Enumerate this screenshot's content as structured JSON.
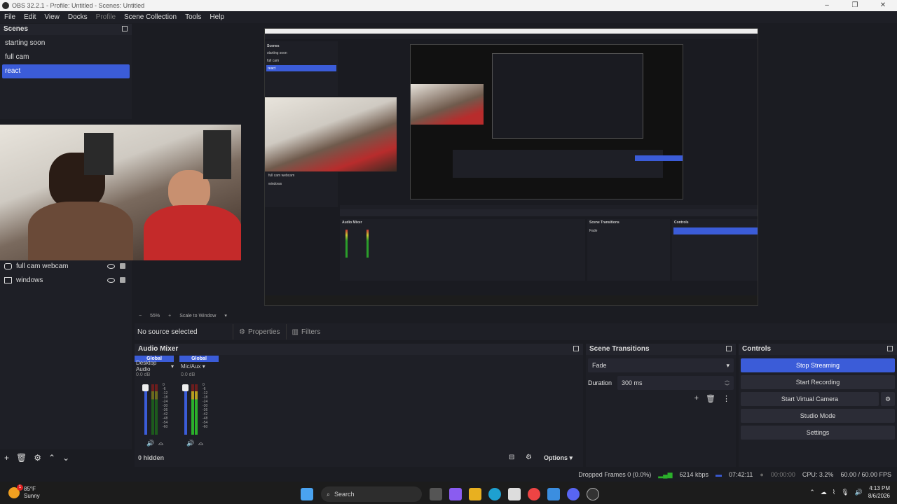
{
  "window": {
    "title": "OBS 32.2.1 - Profile: Untitled - Scenes: Untitled"
  },
  "menu": [
    "File",
    "Edit",
    "View",
    "Docks",
    "Profile",
    "Scene Collection",
    "Tools",
    "Help"
  ],
  "scenes": {
    "title": "Scenes",
    "items": [
      {
        "label": "starting soon",
        "selected": false
      },
      {
        "label": "full cam",
        "selected": false
      },
      {
        "label": "react",
        "selected": true
      }
    ]
  },
  "sources": {
    "items": [
      {
        "label": "full cam webcam",
        "icon": "camera-icon"
      },
      {
        "label": "windows",
        "icon": "window-icon"
      }
    ]
  },
  "preview": {
    "nested_scenes": [
      "starting soon",
      "full cam",
      "react"
    ],
    "nested_sources": [
      "full cam webcam",
      "windows"
    ],
    "zoom_label": "55%",
    "scale_label": "Scale to Window"
  },
  "source_toolbar": {
    "no_source": "No source selected",
    "properties": "Properties",
    "filters": "Filters"
  },
  "mixer": {
    "title": "Audio Mixer",
    "channels": [
      {
        "global": "Global",
        "name": "Desktop Audio",
        "db": "0.0 dB"
      },
      {
        "global": "Global",
        "name": "Mic/Aux",
        "db": "0.0 dB"
      }
    ],
    "scale": [
      "0",
      "-6",
      "-12",
      "-18",
      "-24",
      "-30",
      "-36",
      "-42",
      "-48",
      "-54",
      "-60"
    ],
    "hidden": "0 hidden",
    "options": "Options"
  },
  "transitions": {
    "title": "Scene Transitions",
    "type": "Fade",
    "duration_label": "Duration",
    "duration_value": "300 ms"
  },
  "controls": {
    "title": "Controls",
    "stop_streaming": "Stop Streaming",
    "start_recording": "Start Recording",
    "start_virtual_camera": "Start Virtual Camera",
    "studio_mode": "Studio Mode",
    "settings": "Settings"
  },
  "status": {
    "dropped_frames": "Dropped Frames 0 (0.0%)",
    "bitrate": "6214 kbps",
    "stream_time": "07:42:11",
    "rec_time": "00:00:00",
    "cpu": "CPU: 3.2%",
    "fps": "60.00 / 60.00 FPS"
  },
  "taskbar": {
    "weather_temp": "85°F",
    "weather_desc": "Sunny",
    "search_placeholder": "Search",
    "time": "4:13 PM",
    "date": "8/6/2026",
    "notification_badge": "1"
  },
  "colors": {
    "accent": "#3b5cd8",
    "panel": "#1e1f26",
    "background": "#1b1c22"
  }
}
